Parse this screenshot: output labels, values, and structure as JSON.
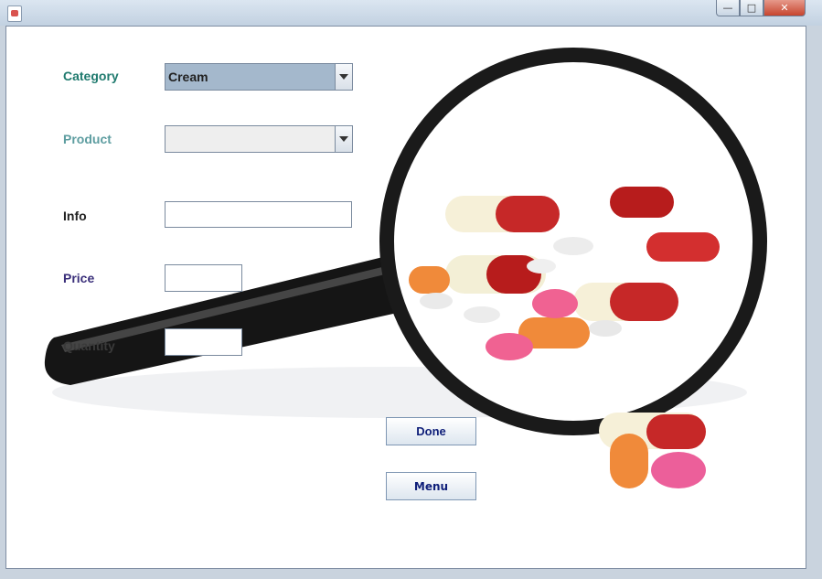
{
  "window": {
    "title": "",
    "controls": {
      "minimize": "—",
      "maximize": "□",
      "close": "✕"
    }
  },
  "form": {
    "category": {
      "label": "Category",
      "value": "Cream",
      "label_color": "#1f7a6e"
    },
    "product": {
      "label": "Product",
      "value": "",
      "label_color": "#5d9da0"
    },
    "info": {
      "label": "Info",
      "value": ""
    },
    "price": {
      "label": "Price",
      "value": ""
    },
    "quantity": {
      "label": "Quantity",
      "value": ""
    }
  },
  "buttons": {
    "done": "Done",
    "menu": "Menu"
  },
  "colors": {
    "category_field": "#a4b8cc",
    "product_field": "#eeeeee",
    "button_text": "#10207a"
  }
}
